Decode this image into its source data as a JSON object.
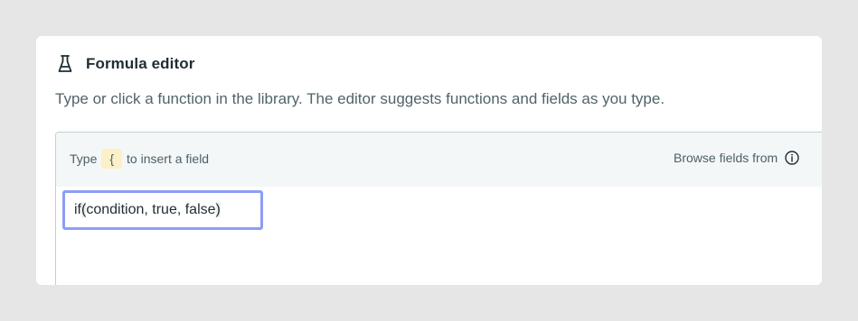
{
  "panel": {
    "title": "Formula editor",
    "subtitle": "Type or click a function in the library. The editor suggests functions and fields as you type."
  },
  "editor": {
    "hint_prefix": "Type",
    "hint_key": "{",
    "hint_suffix": "to insert a field",
    "browse_label": "Browse fields from",
    "formula": {
      "fn": "if",
      "open": "(",
      "args": "condition, true, false",
      "close": ")"
    }
  },
  "icons": {
    "title_icon": "flask-icon",
    "info_icon": "info-icon"
  },
  "colors": {
    "page_bg": "#e6e6e6",
    "focus_outline": "#8c9df8",
    "key_highlight": "#fbf0c8"
  }
}
